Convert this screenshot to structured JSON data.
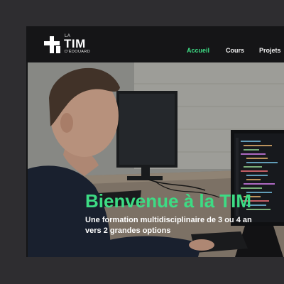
{
  "logo": {
    "la": "LA",
    "tim": "TIM",
    "sub": "D'ÉDOUARD"
  },
  "nav": {
    "items": [
      {
        "label": "Accueil",
        "active": true
      },
      {
        "label": "Cours",
        "active": false
      },
      {
        "label": "Projets",
        "active": false
      }
    ]
  },
  "hero": {
    "title": "Bienvenue à la TIM",
    "subtitle_line1": "Une formation multidisciplinaire de 3 ou 4 an",
    "subtitle_line2": "vers 2 grandes options"
  },
  "colors": {
    "accent": "#3ddc84",
    "background": "#2e2d30",
    "navbar": "#151517"
  }
}
